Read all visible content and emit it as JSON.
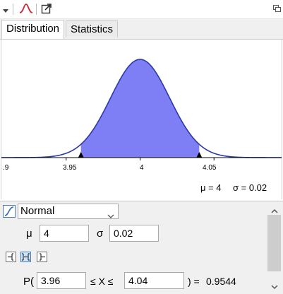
{
  "tabs": [
    {
      "label": "Distribution",
      "active": true
    },
    {
      "label": "Statistics",
      "active": false
    }
  ],
  "toolbar": {
    "icons": [
      "menu-arrow-icon",
      "distribution-curve-icon",
      "export-icon",
      "undock-icon"
    ]
  },
  "chart_data": {
    "type": "area",
    "distribution": "Normal",
    "mean": 4,
    "sd": 0.02,
    "xlim": [
      3.9,
      4.1
    ],
    "x_ticks": [
      ".9",
      "3.95",
      "4",
      "4.05"
    ],
    "shaded_interval": [
      3.96,
      4.04
    ],
    "colors": {
      "curve": "#2b3aa6",
      "fill": "#7f7ff5",
      "axis": "#000000",
      "marker": "#000000"
    }
  },
  "stats_text": {
    "mu": "μ = 4",
    "sigma": "σ = 0.02"
  },
  "controls": {
    "distribution_selected": "Normal",
    "mu_label": "μ",
    "mu_value": "4",
    "sigma_label": "σ",
    "sigma_value": "0.02",
    "interval_buttons": [
      "left-sided-icon",
      "two-sided-icon",
      "right-sided-icon"
    ],
    "probability_prefix": "P(",
    "lower_value": "3.96",
    "middle_text": "≤ X ≤",
    "upper_value": "4.04",
    "equals_text": ") =",
    "result": "0.9544"
  }
}
